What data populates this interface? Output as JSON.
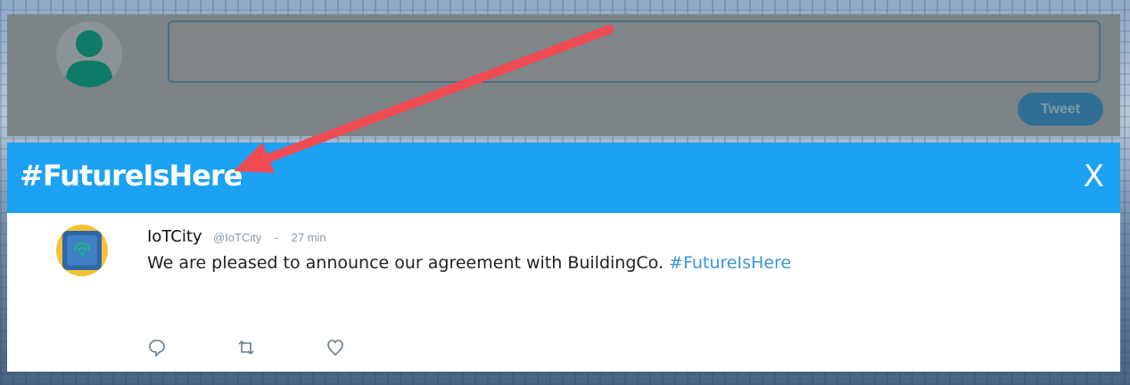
{
  "compose": {
    "textarea_value": "",
    "tweet_button": "Tweet"
  },
  "header": {
    "hashtag": "#FutureIsHere",
    "close_label": "X"
  },
  "tweet": {
    "author": "IoTCity",
    "handle": "@IoTCity",
    "separator": "-",
    "time": "27 min",
    "text": "We are pleased to announce our agreement with BuildingCo.",
    "hashtag": "#FutureIsHere"
  },
  "icons": {
    "reply": "reply-icon",
    "retweet": "retweet-icon",
    "like": "like-icon",
    "avatar": "user-avatar-icon",
    "arrow": "annotation-arrow"
  },
  "colors": {
    "header_bg": "#1da1f2",
    "compose_bg": "#7d8487",
    "tweet_button_bg": "#2f6f95",
    "hashtag_link": "#3b94d9",
    "arrow": "#f04a52"
  }
}
